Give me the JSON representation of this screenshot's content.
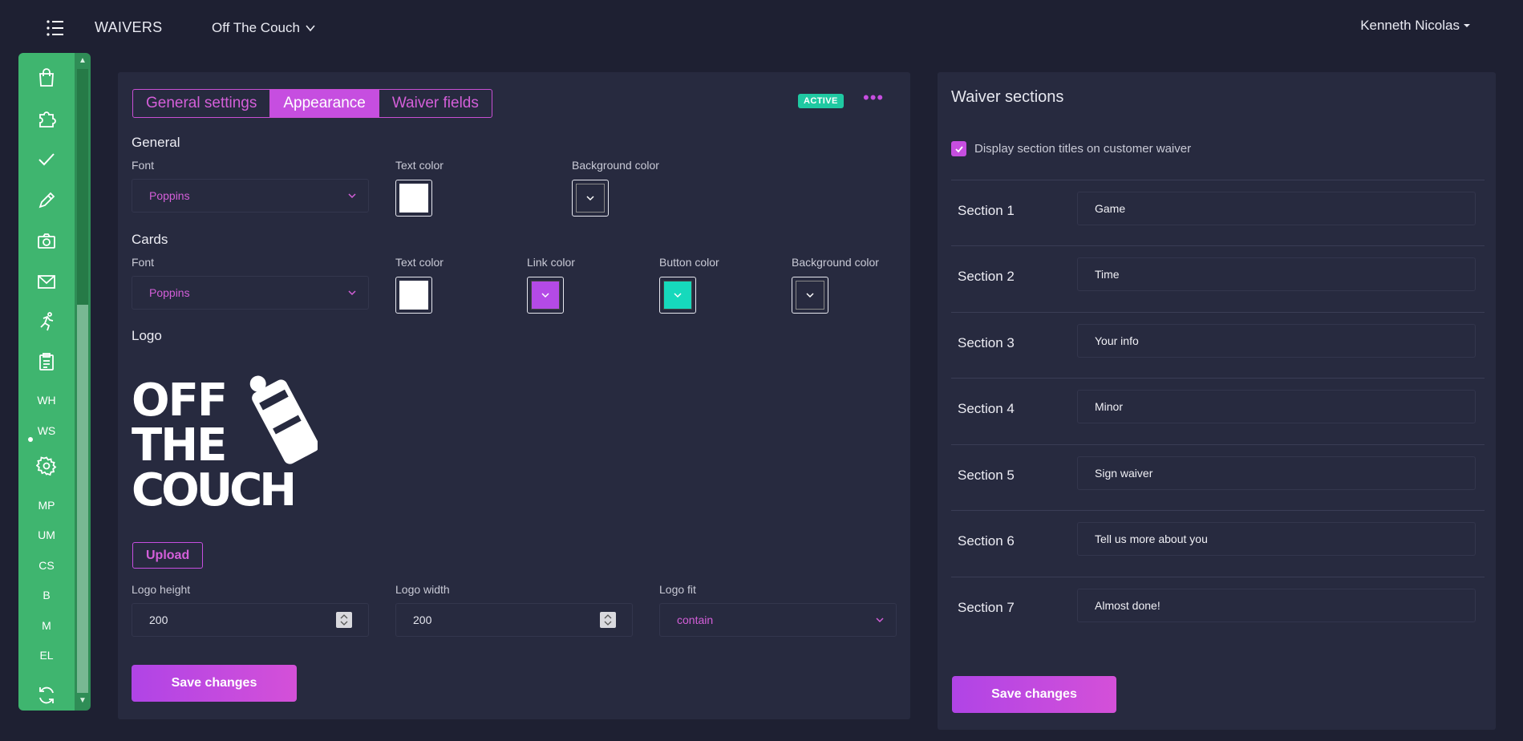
{
  "header": {
    "app_title": "WAIVERS",
    "venue": "Off The Couch",
    "user": "Kenneth Nicolas"
  },
  "rail": {
    "text_items": [
      "WH",
      "WS",
      "MP",
      "UM",
      "CS",
      "B",
      "M",
      "EL"
    ],
    "icons": [
      "bag-icon",
      "puzzle-icon",
      "check-icon",
      "pencil-icon",
      "camera-icon",
      "mail-icon",
      "running-icon",
      "clipboard-icon",
      "gear-icon",
      "refresh-icon"
    ]
  },
  "appearance": {
    "tabs": [
      {
        "label": "General settings",
        "active": false
      },
      {
        "label": "Appearance",
        "active": true
      },
      {
        "label": "Waiver fields",
        "active": false
      }
    ],
    "badge": "ACTIVE",
    "more": "•••",
    "general": {
      "heading": "General",
      "font_label": "Font",
      "font_value": "Poppins",
      "text_color_label": "Text color",
      "text_color": "#ffffff",
      "bg_color_label": "Background color",
      "bg_color": "#272a3f"
    },
    "cards": {
      "heading": "Cards",
      "font_label": "Font",
      "font_value": "Poppins",
      "text_color_label": "Text color",
      "text_color": "#ffffff",
      "link_color_label": "Link color",
      "link_color": "#b44ae6",
      "button_color_label": "Button color",
      "button_color": "#16d9bc",
      "bg_color_label": "Background color",
      "bg_color": "#272a3f"
    },
    "logo": {
      "heading": "Logo",
      "line1": "OFF",
      "line2": "THE",
      "line3": "COUCH",
      "upload_label": "Upload",
      "height_label": "Logo height",
      "height_value": "200",
      "width_label": "Logo width",
      "width_value": "200",
      "fit_label": "Logo fit",
      "fit_value": "contain"
    },
    "save_label": "Save changes"
  },
  "sections": {
    "title": "Waiver sections",
    "display_titles_label": "Display section titles on customer waiver",
    "display_titles_checked": true,
    "items": [
      {
        "label": "Section 1",
        "value": "Game"
      },
      {
        "label": "Section 2",
        "value": "Time"
      },
      {
        "label": "Section 3",
        "value": "Your info"
      },
      {
        "label": "Section 4",
        "value": "Minor"
      },
      {
        "label": "Section 5",
        "value": "Sign waiver"
      },
      {
        "label": "Section 6",
        "value": "Tell us more about you"
      },
      {
        "label": "Section 7",
        "value": "Almost done!"
      }
    ],
    "save_label": "Save changes"
  },
  "colors": {
    "accent": "#c64ee0",
    "rail": "#3fb56f",
    "badge": "#1fc9a2",
    "bg": "#1e2032",
    "panel": "#272a3f"
  }
}
